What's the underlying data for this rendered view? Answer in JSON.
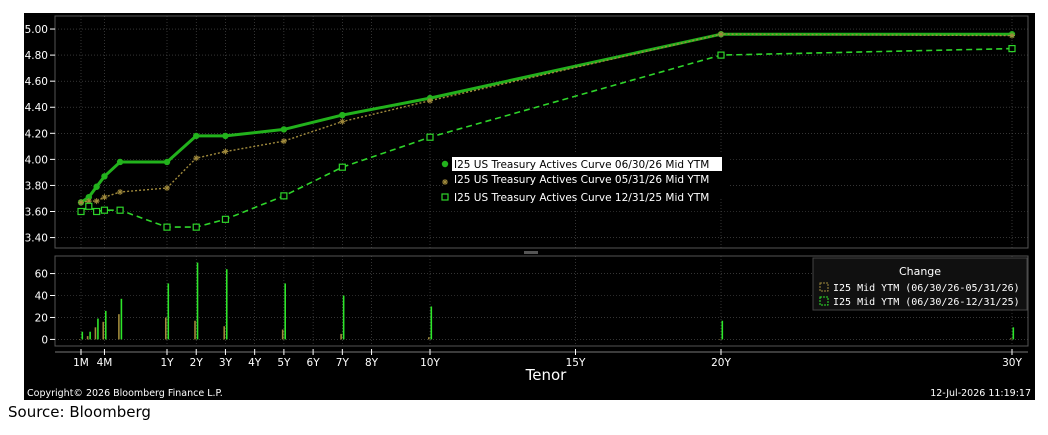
{
  "source_note": "Source: Bloomberg",
  "footer": {
    "copyright": "Copyright© 2026 Bloomberg Finance L.P.",
    "timestamp": "12-Jul-2026 11:19:17"
  },
  "colors": {
    "background": "#000000",
    "grid": "#555555",
    "axis_text": "#ffffff",
    "series_current": "#22b21c",
    "series_month_ago": "#a08a3c",
    "series_dec": "#2ed42a",
    "bars_month": "#a08a3c",
    "bars_dec": "#2ee62a"
  },
  "chart_data": [
    {
      "type": "line",
      "xlabel": "Tenor",
      "x_tick_labels": [
        "1M",
        "4M",
        "1Y",
        "2Y",
        "3Y",
        "4Y",
        "5Y",
        "6Y",
        "7Y",
        "8Y",
        "10Y",
        "15Y",
        "20Y",
        "30Y"
      ],
      "y_tick_labels": [
        "3.40",
        "3.60",
        "3.80",
        "4.00",
        "4.20",
        "4.40",
        "4.60",
        "4.80",
        "5.00"
      ],
      "ylim": [
        3.32,
        5.1
      ],
      "grid": true,
      "legend_position": "center",
      "series": [
        {
          "name": "I25 US Treasury Actives Curve 06/30/26 Mid YTM",
          "marker": "dot",
          "points": [
            {
              "x": "1M",
              "y": 3.67
            },
            {
              "x": "2M",
              "y": 3.71
            },
            {
              "x": "3M",
              "y": 3.79
            },
            {
              "x": "4M",
              "y": 3.87
            },
            {
              "x": "6M",
              "y": 3.98
            },
            {
              "x": "1Y",
              "y": 3.98
            },
            {
              "x": "2Y",
              "y": 4.18
            },
            {
              "x": "3Y",
              "y": 4.18
            },
            {
              "x": "5Y",
              "y": 4.23
            },
            {
              "x": "7Y",
              "y": 4.34
            },
            {
              "x": "10Y",
              "y": 4.47
            },
            {
              "x": "20Y",
              "y": 4.96
            },
            {
              "x": "30Y",
              "y": 4.96
            }
          ]
        },
        {
          "name": "I25 US Treasury Actives Curve 05/31/26 Mid YTM",
          "marker": "star",
          "points": [
            {
              "x": "1M",
              "y": 3.67
            },
            {
              "x": "2M",
              "y": 3.68
            },
            {
              "x": "3M",
              "y": 3.68
            },
            {
              "x": "4M",
              "y": 3.71
            },
            {
              "x": "6M",
              "y": 3.75
            },
            {
              "x": "1Y",
              "y": 3.78
            },
            {
              "x": "2Y",
              "y": 4.01
            },
            {
              "x": "3Y",
              "y": 4.06
            },
            {
              "x": "5Y",
              "y": 4.14
            },
            {
              "x": "7Y",
              "y": 4.29
            },
            {
              "x": "10Y",
              "y": 4.45
            },
            {
              "x": "20Y",
              "y": 4.96
            },
            {
              "x": "30Y",
              "y": 4.95
            }
          ]
        },
        {
          "name": "I25 US Treasury Actives Curve 12/31/25 Mid YTM",
          "marker": "square",
          "points": [
            {
              "x": "1M",
              "y": 3.6
            },
            {
              "x": "2M",
              "y": 3.64
            },
            {
              "x": "3M",
              "y": 3.6
            },
            {
              "x": "4M",
              "y": 3.61
            },
            {
              "x": "6M",
              "y": 3.61
            },
            {
              "x": "1Y",
              "y": 3.48
            },
            {
              "x": "2Y",
              "y": 3.48
            },
            {
              "x": "3Y",
              "y": 3.54
            },
            {
              "x": "5Y",
              "y": 3.72
            },
            {
              "x": "7Y",
              "y": 3.94
            },
            {
              "x": "10Y",
              "y": 4.17
            },
            {
              "x": "20Y",
              "y": 4.8
            },
            {
              "x": "30Y",
              "y": 4.85
            }
          ]
        }
      ]
    },
    {
      "type": "bar",
      "title": "Change",
      "xlabel": "Tenor",
      "y_tick_labels": [
        "0",
        "20",
        "40",
        "60"
      ],
      "ylim": [
        -6,
        76
      ],
      "legend_position": "right",
      "series": [
        {
          "name": "I25 Mid YTM (06/30/26-05/31/26)",
          "points": [
            {
              "x": "1M",
              "y": 0
            },
            {
              "x": "2M",
              "y": 3
            },
            {
              "x": "3M",
              "y": 11
            },
            {
              "x": "4M",
              "y": 16
            },
            {
              "x": "6M",
              "y": 23
            },
            {
              "x": "1Y",
              "y": 20
            },
            {
              "x": "2Y",
              "y": 17
            },
            {
              "x": "3Y",
              "y": 12
            },
            {
              "x": "5Y",
              "y": 9
            },
            {
              "x": "7Y",
              "y": 5
            },
            {
              "x": "10Y",
              "y": 2
            },
            {
              "x": "20Y",
              "y": 0
            },
            {
              "x": "30Y",
              "y": 1
            }
          ]
        },
        {
          "name": "I25 Mid YTM (06/30/26-12/31/25)",
          "points": [
            {
              "x": "1M",
              "y": 7
            },
            {
              "x": "2M",
              "y": 7
            },
            {
              "x": "3M",
              "y": 19
            },
            {
              "x": "4M",
              "y": 26
            },
            {
              "x": "6M",
              "y": 37
            },
            {
              "x": "1Y",
              "y": 51
            },
            {
              "x": "2Y",
              "y": 70
            },
            {
              "x": "3Y",
              "y": 64
            },
            {
              "x": "5Y",
              "y": 51
            },
            {
              "x": "7Y",
              "y": 40
            },
            {
              "x": "10Y",
              "y": 30
            },
            {
              "x": "20Y",
              "y": 17
            },
            {
              "x": "30Y",
              "y": 11
            }
          ]
        }
      ]
    }
  ]
}
